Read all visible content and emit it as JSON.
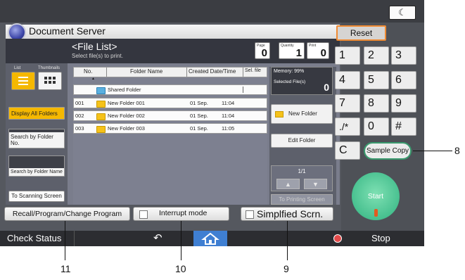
{
  "top": {
    "status_icon": "moon-icon",
    "status_glyph": "☾"
  },
  "app": {
    "title": "Document Server"
  },
  "header": {
    "title": "<File List>",
    "subtitle": "Select file(s) to print.",
    "page_label": "Page",
    "page_value": "0",
    "quantity_label": "Quantity",
    "quantity_value": "1",
    "print_label": "Print",
    "print_value": "0"
  },
  "sidebar": {
    "list_label": "List",
    "thumbnails_label": "Thumbnails",
    "display_all": "Display All Folders",
    "search_folder_no": "Search by Folder No.",
    "search_folder_name": "Search by Folder Name",
    "to_scanning": "To Scanning Screen"
  },
  "table": {
    "headers": [
      "No.",
      "Folder Name",
      "Created Date/Time",
      "Sel. file"
    ],
    "sort_glyph": "▲",
    "shared_folder": "Shared Folder",
    "rows": [
      {
        "no": "001",
        "name": "New Folder 001",
        "date": "01 Sep.",
        "time": "11:04"
      },
      {
        "no": "002",
        "name": "New Folder 002",
        "date": "01 Sep.",
        "time": "11:04"
      },
      {
        "no": "003",
        "name": "New Folder 003",
        "date": "01 Sep.",
        "time": "11:05"
      }
    ]
  },
  "right_panel": {
    "memory": "Memory:  99%",
    "selected_files": "Selected File(s)",
    "selected_count": "0",
    "new_folder": "New Folder",
    "edit_folder": "Edit Folder",
    "page_indicator": "1/1",
    "up_glyph": "▲",
    "down_glyph": "▼",
    "to_printing": "To Printing Screen"
  },
  "bottom": {
    "recall_program": "Recall/Program/Change Program",
    "interrupt_mode": "Interrupt mode",
    "simplified": "Simplfied Scrn."
  },
  "status_bar": {
    "check_status": "Check Status",
    "back_glyph": "↶",
    "home_glyph": "⌂",
    "stop": "Stop"
  },
  "keypad": {
    "reset": "Reset",
    "keys": [
      "1",
      "2",
      "3",
      "4",
      "5",
      "6",
      "7",
      "8",
      "9",
      "./*",
      "0",
      "#",
      "C"
    ],
    "sample_copy": "Sample Copy",
    "start": "Start"
  },
  "callouts": {
    "c8": "8",
    "c9": "9",
    "c10": "10",
    "c11": "11"
  },
  "colors": {
    "accent_orange": "#f08a32",
    "start_green": "#47c08f",
    "highlight_yellow": "#f5b800"
  }
}
